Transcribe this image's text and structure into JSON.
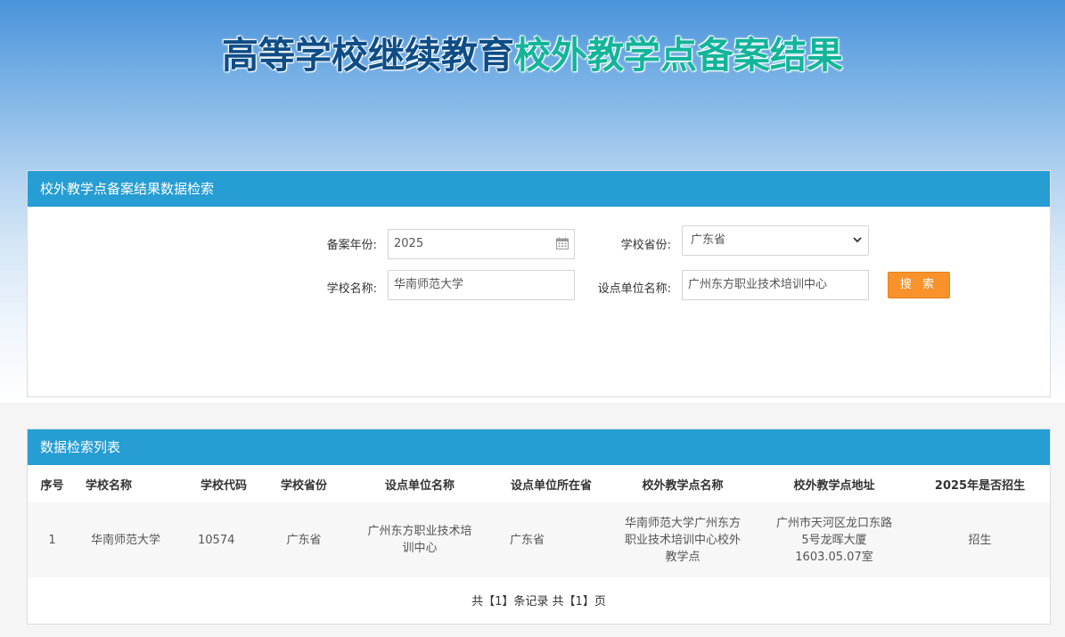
{
  "banner": {
    "title_part1": "高等学校继续教育",
    "title_part2": "校外教学点备案结果"
  },
  "search_panel": {
    "title": "校外教学点备案结果数据检索",
    "year_label": "备案年份:",
    "year_value": "2025",
    "province_label": "学校省份:",
    "province_value": "广东省",
    "school_label": "学校名称:",
    "school_value": "华南师范大学",
    "unit_label": "设点单位名称:",
    "unit_value": "广州东方职业技术培训中心",
    "search_button": "搜 索"
  },
  "list_panel": {
    "title": "数据检索列表",
    "columns": [
      "序号",
      "学校名称",
      "学校代码",
      "学校省份",
      "设点单位名称",
      "设点单位所在省",
      "校外教学点名称",
      "校外教学点地址",
      "2025年是否招生"
    ],
    "rows": [
      {
        "index": "1",
        "school": "华南师范大学",
        "code": "10574",
        "province": "广东省",
        "unit": "广州东方职业技术培训中心",
        "unit_province": "广东省",
        "site_name": "华南师范大学广州东方职业技术培训中心校外教学点",
        "site_address": "广州市天河区龙口东路5号龙晖大厦1603.05.07室",
        "enroll": "招生"
      }
    ],
    "pager": "共【1】条记录 共【1】页"
  },
  "colors": {
    "header_blue": "#269dd3",
    "button_orange": "#f8922a",
    "title_dark": "#0e4d86",
    "title_green": "#13b59a"
  }
}
